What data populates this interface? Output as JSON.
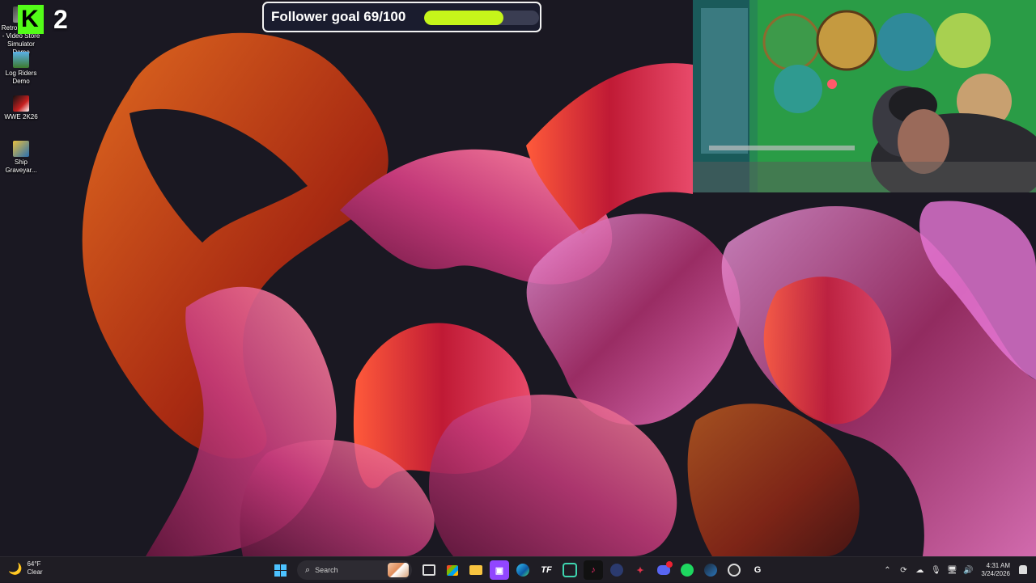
{
  "desktop": {
    "icons": [
      {
        "label": "Retro Rewind - Video Store Simulator Demo",
        "name": "retro-rewind-icon"
      },
      {
        "label": "Log Riders Demo",
        "name": "log-riders-icon"
      },
      {
        "label": "WWE 2K26",
        "name": "wwe-2k26-icon"
      },
      {
        "label": "Ship Graveyar...",
        "name": "ship-graveyard-icon"
      }
    ]
  },
  "overlay": {
    "kick_letter": "K",
    "kick_count": "2",
    "goal_text": "Follower goal 69/100",
    "goal_current": 69,
    "goal_target": 100,
    "goal_color": "#c6f51a"
  },
  "taskbar": {
    "weather_temp": "64°F",
    "weather_desc": "Clear",
    "search_placeholder": "Search",
    "apps": [
      "task-view",
      "microsoft-store",
      "file-explorer",
      "twitch",
      "edge",
      "tradingfuel",
      "copilot",
      "tiktok",
      "stream-tool",
      "surfshark",
      "discord",
      "spotify",
      "steam",
      "obs",
      "chatgpt"
    ],
    "discord_badge": "1",
    "time": "4:31 AM",
    "date": "3/24/2026"
  }
}
